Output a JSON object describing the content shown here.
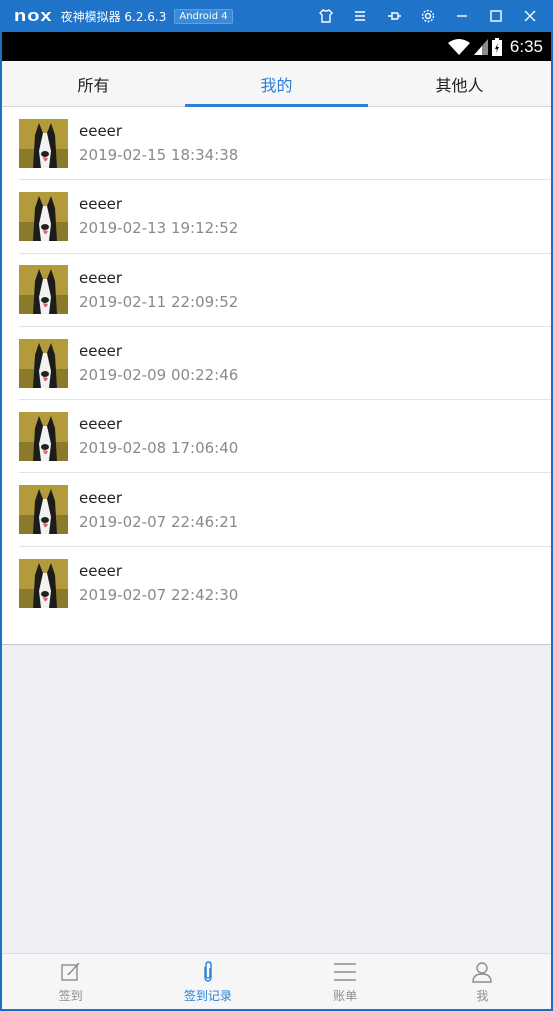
{
  "emulator": {
    "logo": "nox",
    "app_name": "夜神模拟器 6.2.6.3",
    "android_badge": "Android 4",
    "controls": [
      "shirt-icon",
      "menu-icon",
      "pin-icon",
      "gear-icon",
      "minimize-icon",
      "maximize-icon",
      "close-icon"
    ]
  },
  "statusbar": {
    "time": "6:35"
  },
  "tabs": [
    {
      "label": "所有",
      "active": false
    },
    {
      "label": "我的",
      "active": true
    },
    {
      "label": "其他人",
      "active": false
    }
  ],
  "records": [
    {
      "name": "eeeer",
      "time": "2019-02-15 18:34:38"
    },
    {
      "name": "eeeer",
      "time": "2019-02-13 19:12:52"
    },
    {
      "name": "eeeer",
      "time": "2019-02-11 22:09:52"
    },
    {
      "name": "eeeer",
      "time": "2019-02-09 00:22:46"
    },
    {
      "name": "eeeer",
      "time": "2019-02-08 17:06:40"
    },
    {
      "name": "eeeer",
      "time": "2019-02-07 22:46:21"
    },
    {
      "name": "eeeer",
      "time": "2019-02-07 22:42:30"
    }
  ],
  "bottom_nav": [
    {
      "label": "签到",
      "icon": "edit-icon",
      "active": false
    },
    {
      "label": "签到记录",
      "icon": "paperclip-icon",
      "active": true
    },
    {
      "label": "账单",
      "icon": "list-icon",
      "active": false
    },
    {
      "label": "我",
      "icon": "user-icon",
      "active": false
    }
  ],
  "colors": {
    "accent": "#2b7fd6",
    "titlebar": "#1f73c9"
  }
}
